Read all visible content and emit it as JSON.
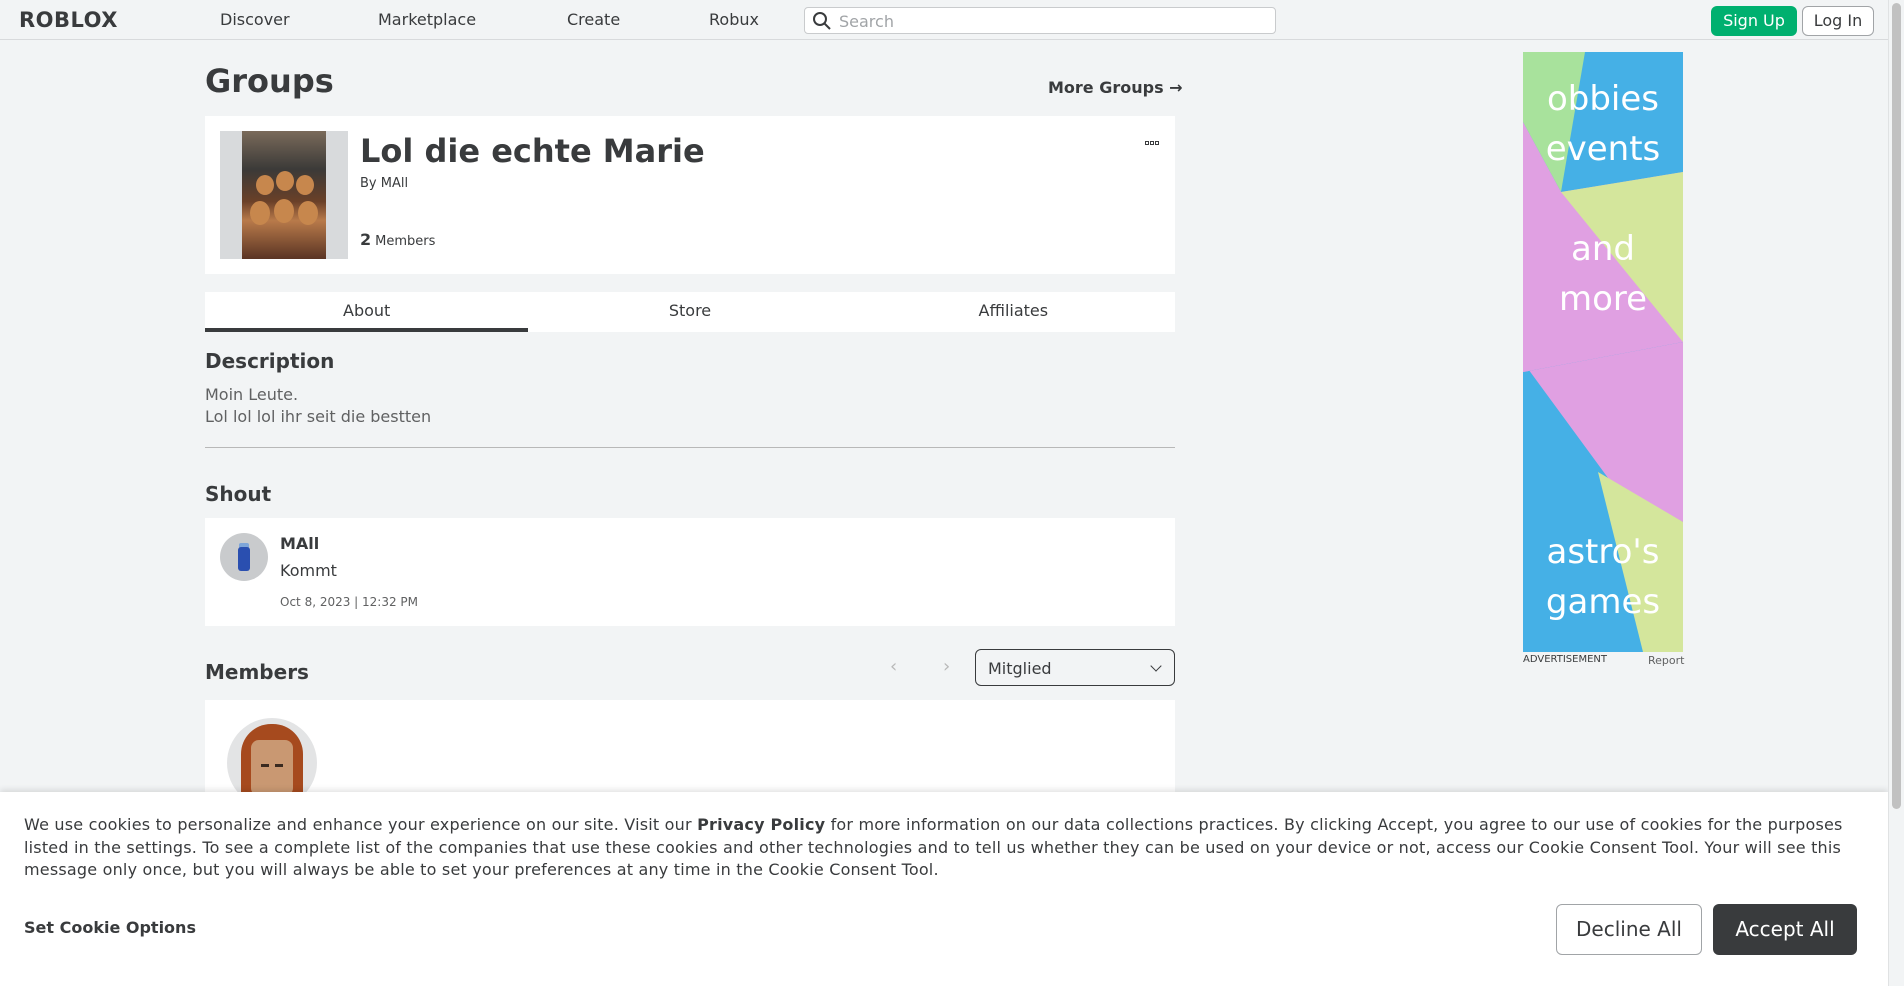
{
  "header": {
    "logo": "ROBLOX",
    "nav": [
      "Discover",
      "Marketplace",
      "Create",
      "Robux"
    ],
    "search_placeholder": "Search",
    "signup_label": "Sign Up",
    "login_label": "Log In"
  },
  "page": {
    "title": "Groups",
    "more_groups": "More Groups →"
  },
  "group": {
    "name": "Lol die echte Marie",
    "by_label": "By",
    "owner": "MAll",
    "member_count": "2",
    "members_label": "Members"
  },
  "tabs": [
    {
      "label": "About",
      "active": true
    },
    {
      "label": "Store",
      "active": false
    },
    {
      "label": "Affiliates",
      "active": false
    }
  ],
  "about": {
    "description_heading": "Description",
    "description_lines": [
      "Moin Leute.",
      "Lol lol lol ihr seit die bestten"
    ]
  },
  "shout": {
    "heading": "Shout",
    "user": "MAll",
    "text": "Kommt",
    "date": "Oct 8, 2023 | 12:32 PM"
  },
  "members": {
    "heading": "Members",
    "role_selected": "Mitglied",
    "prev_glyph": "‹",
    "next_glyph": "›"
  },
  "ad": {
    "lines": [
      "obbies",
      "events",
      "and",
      "more",
      "astro's",
      "games"
    ],
    "label": "ADVERTISEMENT",
    "report": "Report",
    "colors": {
      "green": "#a8e29c",
      "blue": "#45b0e6",
      "pink": "#e0a0e2",
      "lime": "#d4e69c"
    }
  },
  "cookie": {
    "text_before": "We use cookies to personalize and enhance your experience on our site. Visit our ",
    "privacy_link": "Privacy Policy",
    "text_after": " for more information on our data collections practices. By clicking Accept, you agree to our use of cookies for the purposes listed in the settings. To see a complete list of the companies that use these cookies and other technologies and to tell us whether they can be used on your device or not, access our Cookie Consent Tool. Your will see this message only once, but you will always be able to set your preferences at any time in the Cookie Consent Tool.",
    "options_label": "Set Cookie Options",
    "decline_label": "Decline All",
    "accept_label": "Accept All"
  },
  "colors": {
    "accent_green": "#00b06f",
    "text_dark": "#393b3d",
    "background": "#f2f4f5"
  }
}
